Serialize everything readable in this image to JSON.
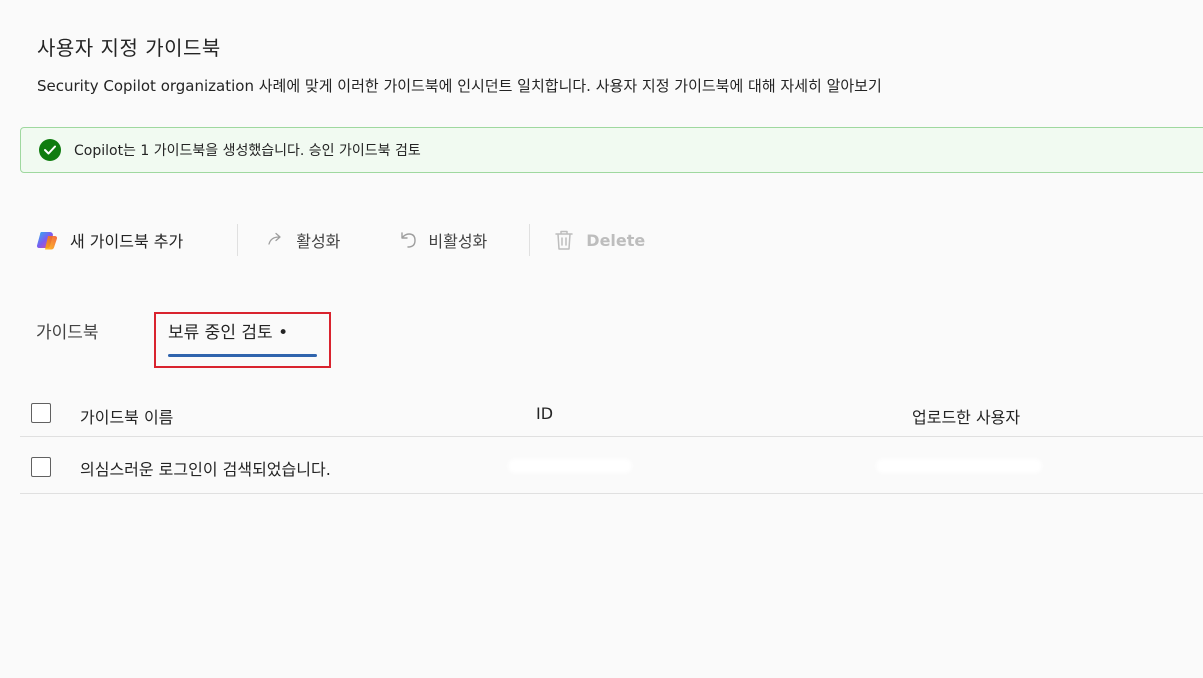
{
  "page": {
    "title": "사용자 지정 가이드북",
    "description": "Security Copilot organization 사례에 맞게 이러한 가이드북에 인시던트 일치합니다.",
    "learn_more": "사용자 지정 가이드북에 대해 자세히 알아보기"
  },
  "banner": {
    "message": "Copilot는 1 가이드북을 생성했습니다. 승인 가이드북 검토",
    "status_color": "#107c10",
    "icon": "checkmark-circle-icon"
  },
  "toolbar": {
    "add_label": "새 가이드북 추가",
    "activate_label": "활성화",
    "deactivate_label": "비활성화",
    "delete_label": "Delete",
    "icons": [
      "copilot-icon",
      "arrow-forward-icon",
      "undo-icon",
      "trash-icon"
    ]
  },
  "tabs": {
    "items": [
      {
        "label": "가이드북",
        "selected": false
      },
      {
        "label": "보류 중인 검토",
        "badge": "•",
        "selected": true
      }
    ],
    "accent_color": "#2f64ad"
  },
  "table": {
    "columns": [
      "가이드북 이름",
      "ID",
      "업로드한 사용자"
    ],
    "rows": [
      {
        "name": "의심스러운 로그인이 검색되었습니다.",
        "id": "",
        "uploaded_by": ""
      }
    ]
  }
}
